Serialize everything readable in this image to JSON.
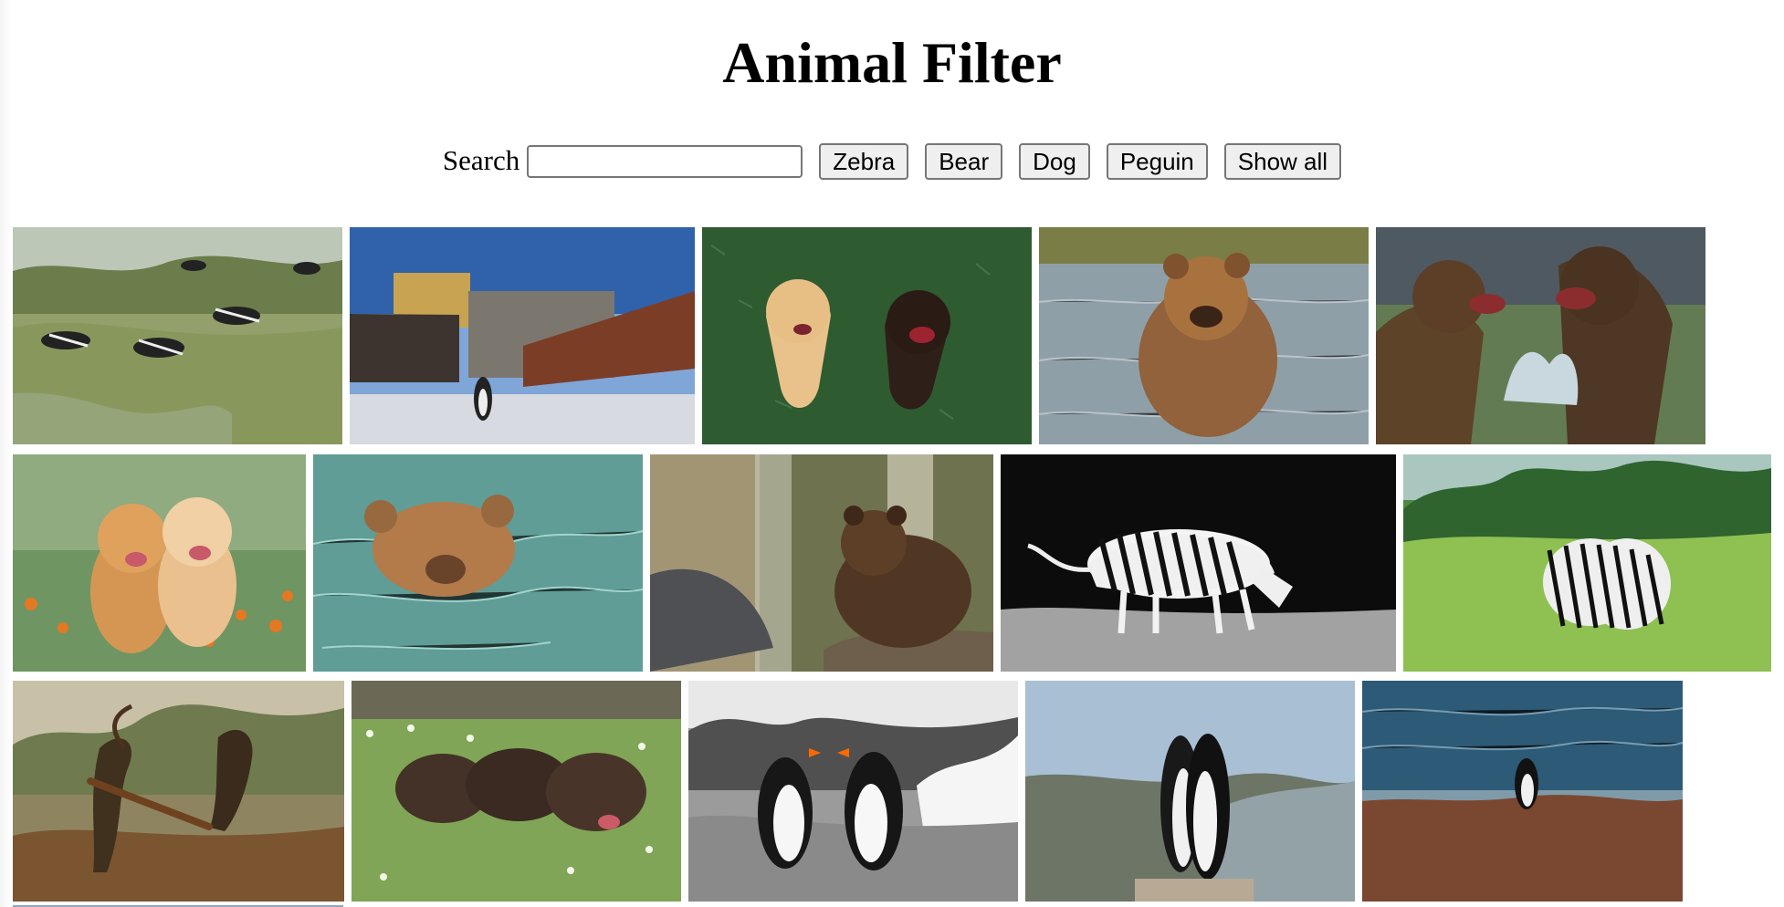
{
  "page": {
    "title": "Animal Filter"
  },
  "search": {
    "label": "Search",
    "value": "",
    "placeholder": ""
  },
  "filters": [
    {
      "label": "Zebra"
    },
    {
      "label": "Bear"
    },
    {
      "label": "Dog"
    },
    {
      "label": "Peguin"
    },
    {
      "label": "Show all"
    }
  ],
  "gallery": {
    "items": [
      {
        "name": "zebra-herd-image"
      },
      {
        "name": "penguin-town-image"
      },
      {
        "name": "two-dogs-image"
      },
      {
        "name": "bear-in-river-image"
      },
      {
        "name": "fighting-bears-image"
      },
      {
        "name": "puppies-flowers-image"
      },
      {
        "name": "swimming-bear-image"
      },
      {
        "name": "bear-zoo-image"
      },
      {
        "name": "zebra-dark-image"
      },
      {
        "name": "two-zebras-image"
      },
      {
        "name": "dogs-stick-image"
      },
      {
        "name": "sleeping-puppies-image"
      },
      {
        "name": "penguins-rocks-image"
      },
      {
        "name": "kissing-penguins-image"
      },
      {
        "name": "penguin-sea-image"
      }
    ]
  }
}
